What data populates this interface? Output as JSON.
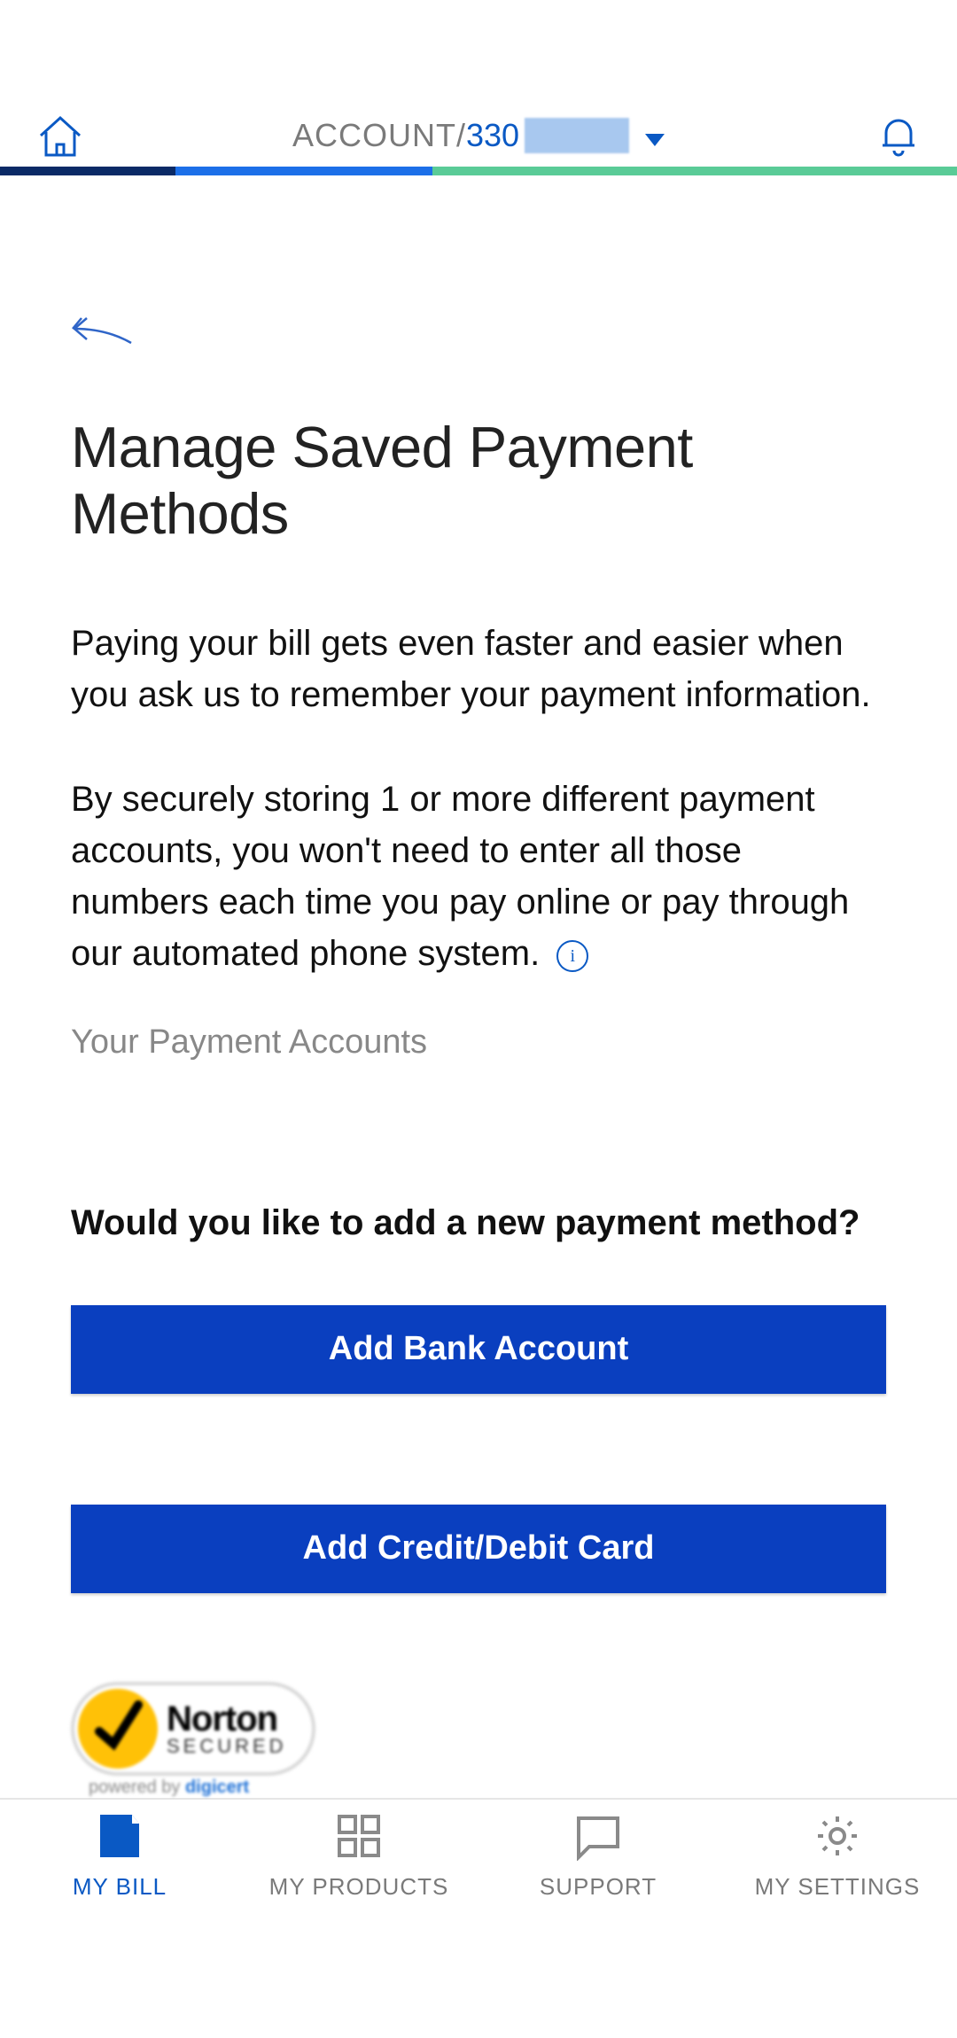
{
  "header": {
    "account_label": "ACCOUNT/",
    "account_number_visible": "330"
  },
  "page": {
    "title": "Manage Saved Payment Methods",
    "intro1": "Paying your bill gets even faster and easier when you ask us to remember your payment information.",
    "intro2": "By securely storing 1 or more different payment accounts, you won't need to enter all those numbers each time you pay online or pay through our automated phone system.",
    "section_label": "Your Payment Accounts",
    "prompt": "Would you like to add a new payment method?",
    "btn_bank": "Add Bank Account",
    "btn_card": "Add Credit/Debit Card"
  },
  "badge": {
    "brand": "Norton",
    "line2": "SECURED",
    "sub_prefix": "powered by ",
    "sub_brand": "digicert"
  },
  "tabs": {
    "bill": "MY BILL",
    "products": "MY PRODUCTS",
    "support": "SUPPORT",
    "settings": "MY SETTINGS",
    "active": "bill"
  }
}
